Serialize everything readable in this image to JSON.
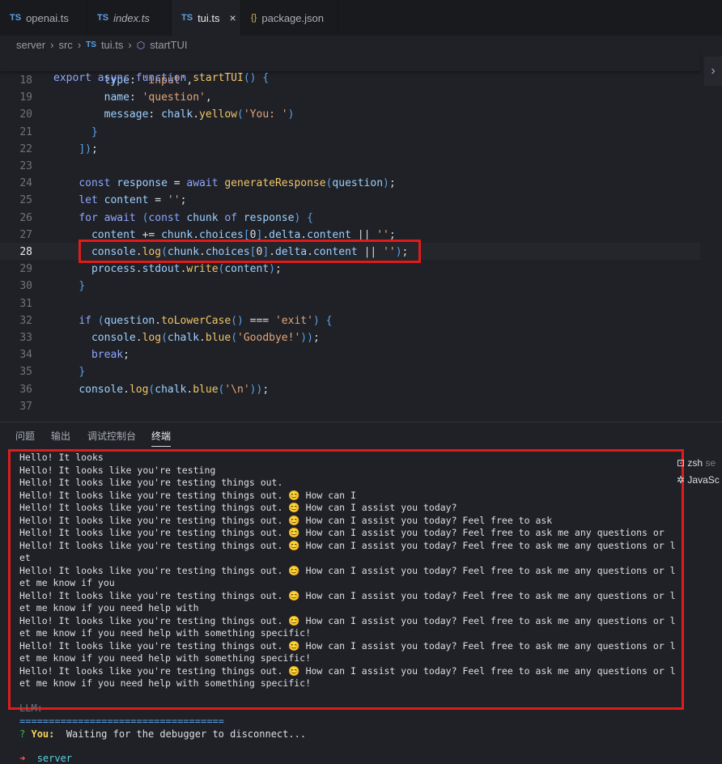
{
  "tabs": [
    {
      "icon": "TS",
      "label": "openai.ts",
      "italic": false,
      "active": false
    },
    {
      "icon": "TS",
      "label": "index.ts",
      "italic": true,
      "active": false
    },
    {
      "icon": "TS",
      "label": "tui.ts",
      "italic": false,
      "active": true
    },
    {
      "icon": "{}",
      "label": "package.json",
      "italic": false,
      "active": false
    }
  ],
  "breadcrumb": {
    "part1": "server",
    "part2": "src",
    "part3_icon": "TS",
    "part3": "tui.ts",
    "part4": "startTUI"
  },
  "sticky_header": {
    "kw1": "export",
    "kw2": "async",
    "kw3": "function",
    "fn": "startTUI",
    "rest": "() {"
  },
  "code_lines": [
    {
      "n": "18",
      "text": "        type: 'input',"
    },
    {
      "n": "19",
      "text": "        name: 'question',"
    },
    {
      "n": "20",
      "text": "        message: chalk.yellow('You: ')"
    },
    {
      "n": "21",
      "text": "      }"
    },
    {
      "n": "22",
      "text": "    ]);"
    },
    {
      "n": "23",
      "text": ""
    },
    {
      "n": "24",
      "text": "    const response = await generateResponse(question);"
    },
    {
      "n": "25",
      "text": "    let content = '';"
    },
    {
      "n": "26",
      "text": "    for await (const chunk of response) {"
    },
    {
      "n": "27",
      "text": "      content += chunk.choices[0].delta.content || '';"
    },
    {
      "n": "28",
      "text": "      console.log(chunk.choices[0].delta.content || '');"
    },
    {
      "n": "29",
      "text": "      process.stdout.write(content);"
    },
    {
      "n": "30",
      "text": "    }"
    },
    {
      "n": "31",
      "text": ""
    },
    {
      "n": "32",
      "text": "    if (question.toLowerCase() === 'exit') {"
    },
    {
      "n": "33",
      "text": "      console.log(chalk.blue('Goodbye!'));"
    },
    {
      "n": "34",
      "text": "      break;"
    },
    {
      "n": "35",
      "text": "    }"
    },
    {
      "n": "36",
      "text": "    console.log(chalk.blue('\\n'));"
    },
    {
      "n": "37",
      "text": ""
    }
  ],
  "panel_tabs": [
    "问题",
    "输出",
    "调试控制台",
    "终端"
  ],
  "terminal_lines": [
    "Hello! It looks",
    "Hello! It looks like you're testing",
    "Hello! It looks like you're testing things out.",
    "Hello! It looks like you're testing things out. 😊 How can I",
    "Hello! It looks like you're testing things out. 😊 How can I assist you today?",
    "Hello! It looks like you're testing things out. 😊 How can I assist you today? Feel free to ask",
    "Hello! It looks like you're testing things out. 😊 How can I assist you today? Feel free to ask me any questions or",
    "Hello! It looks like you're testing things out. 😊 How can I assist you today? Feel free to ask me any questions or l",
    "et",
    "Hello! It looks like you're testing things out. 😊 How can I assist you today? Feel free to ask me any questions or l",
    "et me know if you",
    "Hello! It looks like you're testing things out. 😊 How can I assist you today? Feel free to ask me any questions or l",
    "et me know if you need help with",
    "Hello! It looks like you're testing things out. 😊 How can I assist you today? Feel free to ask me any questions or l",
    "et me know if you need help with something specific!",
    "Hello! It looks like you're testing things out. 😊 How can I assist you today? Feel free to ask me any questions or l",
    "et me know if you need help with something specific!",
    "Hello! It looks like you're testing things out. 😊 How can I assist you today? Feel free to ask me any questions or l",
    "et me know if you need help with something specific!"
  ],
  "terminal_footer": {
    "llm_label": "LLM:",
    "rule": "===================================",
    "prompt_mark": "?",
    "you_label": "You:",
    "status": " Waiting for the debugger to disconnect...",
    "dir_arrow": "➜",
    "dir": "server"
  },
  "terminal_list": [
    {
      "name": "zsh",
      "suffix": "se"
    },
    {
      "name": "JavaSc",
      "suffix": ""
    }
  ],
  "colors": {
    "red_box": "#e01b1b",
    "editor_bg": "#1f2126"
  }
}
